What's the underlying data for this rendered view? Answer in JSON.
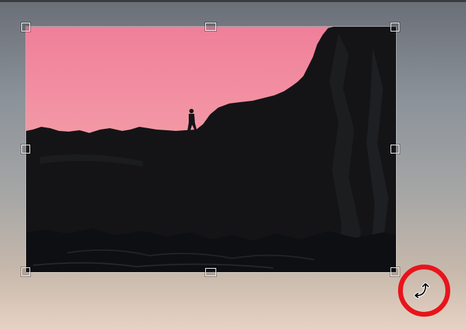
{
  "editor": {
    "state": "image-selected",
    "selected_object": "image",
    "handles": [
      "top-left",
      "top-center",
      "top-right",
      "middle-left",
      "middle-right",
      "bottom-left",
      "bottom-center",
      "bottom-right"
    ],
    "cursor": "rotate-icon",
    "highlight": {
      "shape": "circle",
      "color": "#e8141b",
      "target": "rotate-cursor"
    }
  },
  "colors": {
    "sky_top": "#f07f9a",
    "sky_horizon": "#f4a2a9",
    "glow": "#f8762e",
    "rock": "#141416",
    "handle_border": "#ffffff"
  }
}
